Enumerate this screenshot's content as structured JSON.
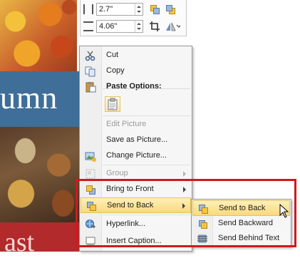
{
  "document": {
    "title_fragment": "umn",
    "banner_fragment": "ast"
  },
  "size_ribbon": {
    "height_value": "2.7\"",
    "width_value": "4.06\""
  },
  "context_menu": {
    "cut": "Cut",
    "copy": "Copy",
    "paste_options": "Paste Options:",
    "edit_picture": "Edit Picture",
    "save_as_picture": "Save as Picture...",
    "change_picture": "Change Picture...",
    "group": "Group",
    "bring_to_front": "Bring to Front",
    "send_to_back": "Send to Back",
    "hyperlink": "Hyperlink...",
    "insert_caption": "Insert Caption..."
  },
  "submenu": {
    "send_to_back": "Send to Back",
    "send_backward": "Send Backward",
    "send_behind_text": "Send Behind Text"
  },
  "colors": {
    "highlight": "#f9d97c",
    "annotation": "#d0191d",
    "title_band": "#3f6e99",
    "banner": "#b22a2c"
  }
}
